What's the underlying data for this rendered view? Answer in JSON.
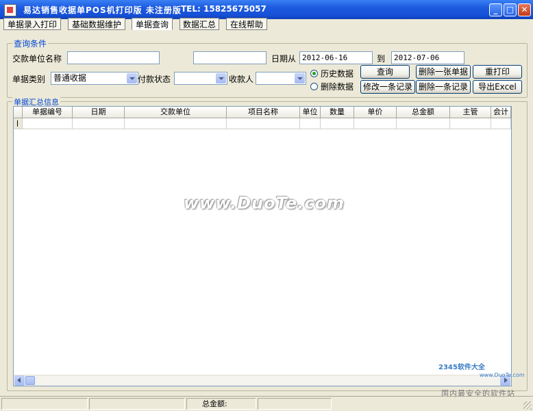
{
  "window": {
    "title": "易达销售收据单POS机打印版 未注册版",
    "tel": "TEL: 15825675057"
  },
  "menu": {
    "items": [
      "单据录入打印",
      "基础数据维护",
      "单据查询",
      "数据汇总",
      "在线帮助"
    ],
    "active_index": 2
  },
  "query": {
    "group_title": "查询条件",
    "payer_label": "交款单位名称",
    "payer_value": "",
    "extra_value": "",
    "date_from_label": "日期从",
    "date_from": "2012-06-16",
    "date_to_label": "到",
    "date_to": "2012-07-06",
    "doc_type_label": "单据类别",
    "doc_type_value": "普通收据",
    "pay_status_label": "付款状态",
    "pay_status_value": "",
    "payee_label": "收款人",
    "payee_value": "",
    "radio_history": "历史数据",
    "radio_deleted": "删除数据",
    "radio_selected": "history"
  },
  "buttons": {
    "query": "查询",
    "delete_doc": "删除一张单据",
    "reprint": "重打印",
    "edit_record": "修改一条记录",
    "delete_record": "删除一条记录",
    "export_excel": "导出Excel"
  },
  "summary": {
    "group_title": "单据汇总信息",
    "columns": [
      "单据编号",
      "日期",
      "交款单位",
      "项目名称",
      "单位",
      "数量",
      "单价",
      "总金额",
      "主管",
      "会计"
    ]
  },
  "status": {
    "total_label": "总金额:"
  },
  "watermarks": {
    "center": "www.DuoTe.com",
    "logo": "2345软件大全",
    "logo_url": "www.DuoTe.com",
    "caption": "国内最安全的软件站"
  }
}
